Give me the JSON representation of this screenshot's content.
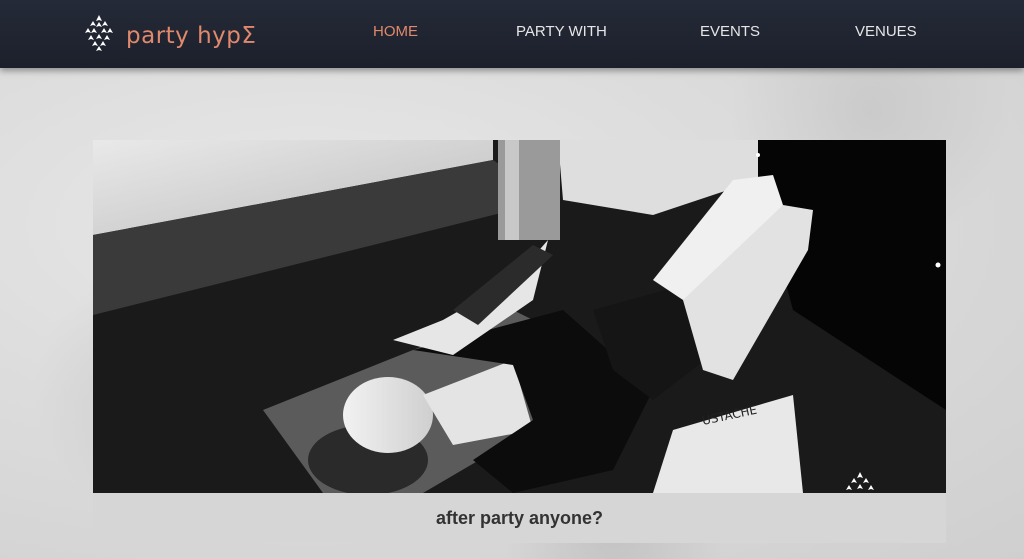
{
  "brand": {
    "name": "party hypΣ",
    "logo_icon": "pinecone-icon",
    "accent_color": "#e0896c"
  },
  "nav": {
    "items": [
      {
        "label": "HOME",
        "active": true
      },
      {
        "label": "PARTY WITH",
        "active": false
      },
      {
        "label": "EVENTS",
        "active": false
      },
      {
        "label": "VENUES",
        "active": false
      }
    ]
  },
  "feature": {
    "image_subject": "black-and-white photo of a woman lying on a floor",
    "caption": "after party anyone?",
    "watermark_icon": "pinecone-icon"
  }
}
